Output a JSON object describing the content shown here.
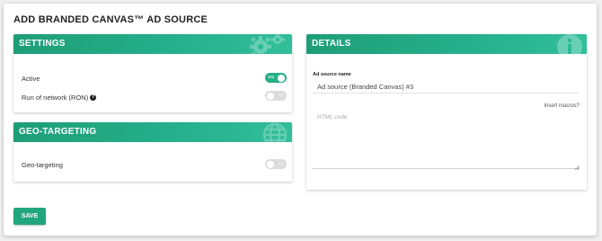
{
  "page": {
    "title": "ADD BRANDED CANVAS™ AD SOURCE"
  },
  "settings": {
    "title": "SETTINGS",
    "header_icon": "gears-icon",
    "active_label": "Active",
    "active_toggle": {
      "state": "on",
      "label": "YES"
    },
    "ron_label": "Run of network (RON)",
    "ron_help_icon": "question-circle-icon",
    "ron_toggle": {
      "state": "off",
      "label": "NO"
    }
  },
  "geo": {
    "title": "GEO-TARGETING",
    "header_icon": "globe-icon",
    "label": "Geo-targeting",
    "toggle": {
      "state": "off",
      "label": "NO"
    }
  },
  "details": {
    "title": "DETAILS",
    "header_icon": "info-icon",
    "name_label": "Ad source name",
    "name_value": "Ad source (Branded Canvas) #3",
    "insert_macros": "Insert macros?",
    "html_placeholder": "HTML code",
    "html_value": ""
  },
  "save_label": "SAVE",
  "colors": {
    "accent": "#27ae86",
    "toggle_off": "#dcdcdc",
    "header_gradient_end": "#32bf9a"
  }
}
